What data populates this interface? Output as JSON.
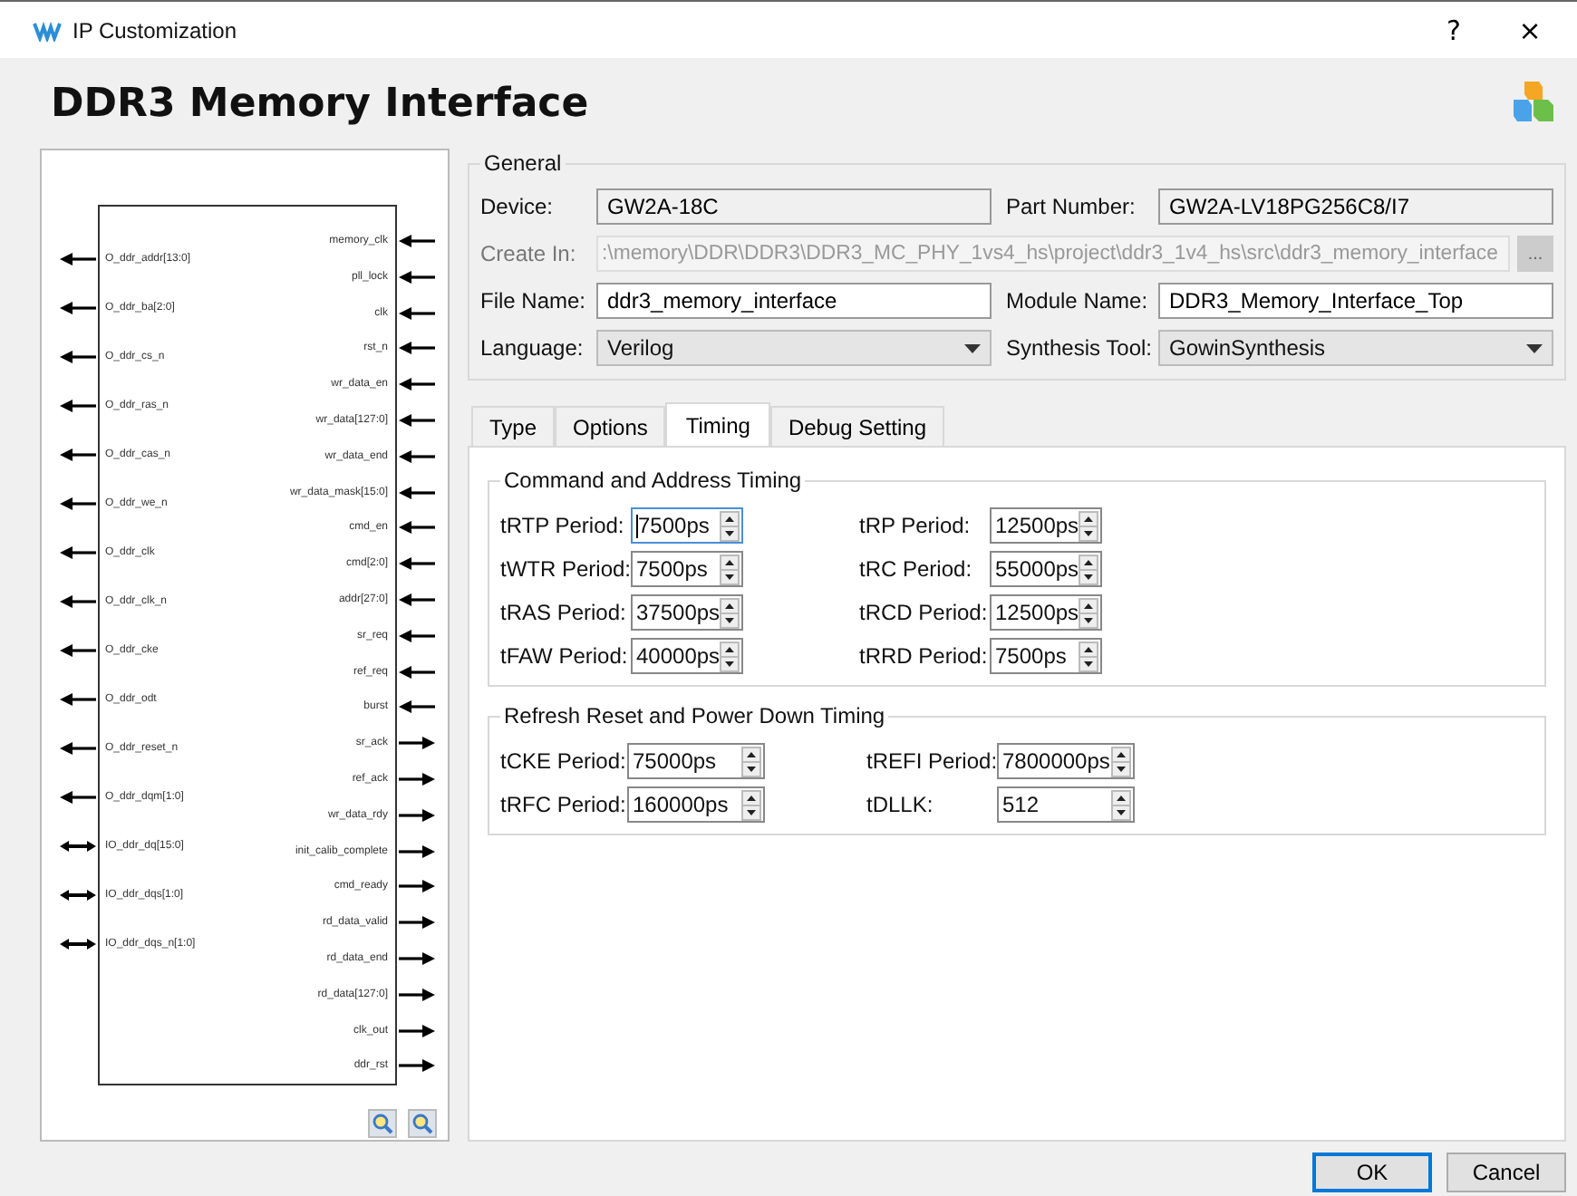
{
  "window": {
    "title": "IP Customization",
    "help": "?",
    "close": "×"
  },
  "header": {
    "title": "DDR3 Memory Interface"
  },
  "diagram": {
    "left_pins": [
      {
        "name": "O_ddr_addr[13:0]",
        "kind": "output"
      },
      {
        "name": "O_ddr_ba[2:0]",
        "kind": "output"
      },
      {
        "name": "O_ddr_cs_n",
        "kind": "output"
      },
      {
        "name": "O_ddr_ras_n",
        "kind": "output"
      },
      {
        "name": "O_ddr_cas_n",
        "kind": "output"
      },
      {
        "name": "O_ddr_we_n",
        "kind": "output"
      },
      {
        "name": "O_ddr_clk",
        "kind": "output"
      },
      {
        "name": "O_ddr_clk_n",
        "kind": "output"
      },
      {
        "name": "O_ddr_cke",
        "kind": "output"
      },
      {
        "name": "O_ddr_odt",
        "kind": "output"
      },
      {
        "name": "O_ddr_reset_n",
        "kind": "output"
      },
      {
        "name": "O_ddr_dqm[1:0]",
        "kind": "output"
      },
      {
        "name": "IO_ddr_dq[15:0]",
        "kind": "inout"
      },
      {
        "name": "IO_ddr_dqs[1:0]",
        "kind": "inout"
      },
      {
        "name": "IO_ddr_dqs_n[1:0]",
        "kind": "inout"
      }
    ],
    "right_pins": [
      {
        "name": "memory_clk",
        "kind": "input"
      },
      {
        "name": "pll_lock",
        "kind": "input"
      },
      {
        "name": "clk",
        "kind": "input"
      },
      {
        "name": "rst_n",
        "kind": "input"
      },
      {
        "name": "wr_data_en",
        "kind": "input"
      },
      {
        "name": "wr_data[127:0]",
        "kind": "input"
      },
      {
        "name": "wr_data_end",
        "kind": "input"
      },
      {
        "name": "wr_data_mask[15:0]",
        "kind": "input"
      },
      {
        "name": "cmd_en",
        "kind": "input"
      },
      {
        "name": "cmd[2:0]",
        "kind": "input"
      },
      {
        "name": "addr[27:0]",
        "kind": "input"
      },
      {
        "name": "sr_req",
        "kind": "input"
      },
      {
        "name": "ref_req",
        "kind": "input"
      },
      {
        "name": "burst",
        "kind": "input"
      },
      {
        "name": "sr_ack",
        "kind": "output"
      },
      {
        "name": "ref_ack",
        "kind": "output"
      },
      {
        "name": "wr_data_rdy",
        "kind": "output"
      },
      {
        "name": "init_calib_complete",
        "kind": "output"
      },
      {
        "name": "cmd_ready",
        "kind": "output"
      },
      {
        "name": "rd_data_valid",
        "kind": "output"
      },
      {
        "name": "rd_data_end",
        "kind": "output"
      },
      {
        "name": "rd_data[127:0]",
        "kind": "output"
      },
      {
        "name": "clk_out",
        "kind": "output"
      },
      {
        "name": "ddr_rst",
        "kind": "output"
      }
    ]
  },
  "general": {
    "title": "General",
    "rows": [
      [
        {
          "label": "Device:",
          "value": "GW2A-18C",
          "kind": "readonly"
        },
        {
          "label": "Part Number:",
          "value": "GW2A-LV18PG256C8/I7",
          "kind": "readonly"
        }
      ],
      [
        {
          "label": "Create In:",
          "value": ":\\memory\\DDR\\DDR3\\DDR3_MC_PHY_1vs4_hs\\project\\ddr3_1v4_hs\\src\\ddr3_memory_interface",
          "kind": "path",
          "button": "..."
        }
      ],
      [
        {
          "label": "File Name:",
          "value": "ddr3_memory_interface",
          "kind": "text"
        },
        {
          "label": "Module Name:",
          "value": "DDR3_Memory_Interface_Top",
          "kind": "text"
        }
      ],
      [
        {
          "label": "Language:",
          "value": "Verilog",
          "kind": "dropdown"
        },
        {
          "label": "Synthesis Tool:",
          "value": "GowinSynthesis",
          "kind": "dropdown"
        }
      ]
    ]
  },
  "tabs": [
    {
      "label": "Type",
      "selected": false
    },
    {
      "label": "Options",
      "selected": false
    },
    {
      "label": "Timing",
      "selected": true
    },
    {
      "label": "Debug Setting",
      "selected": false
    }
  ],
  "timing_groups": [
    {
      "title": "Command and Address Timing",
      "fields": [
        {
          "label": "tRTP Period:",
          "value": "7500ps",
          "focused": true
        },
        {
          "label": "tRP Period:",
          "value": "12500ps",
          "focused": false
        },
        {
          "label": "tWTR Period:",
          "value": "7500ps",
          "focused": false
        },
        {
          "label": "tRC Period:",
          "value": "55000ps",
          "focused": false
        },
        {
          "label": "tRAS Period:",
          "value": "37500ps",
          "focused": false
        },
        {
          "label": "tRCD Period:",
          "value": "12500ps",
          "focused": false
        },
        {
          "label": "tFAW Period:",
          "value": "40000ps",
          "focused": false
        },
        {
          "label": "tRRD Period:",
          "value": "7500ps",
          "focused": false
        }
      ]
    },
    {
      "title": "Refresh Reset and Power Down Timing",
      "fields": [
        {
          "label": "tCKE Period:",
          "value": "75000ps",
          "focused": false
        },
        {
          "label": "tREFI Period:",
          "value": "7800000ps",
          "focused": false
        },
        {
          "label": "tRFC Period:",
          "value": "160000ps",
          "focused": false
        },
        {
          "label": "tDLLK:",
          "value": "512",
          "focused": false
        }
      ]
    }
  ],
  "buttons": [
    {
      "label": "OK",
      "default": true
    },
    {
      "label": "Cancel",
      "default": false
    }
  ]
}
